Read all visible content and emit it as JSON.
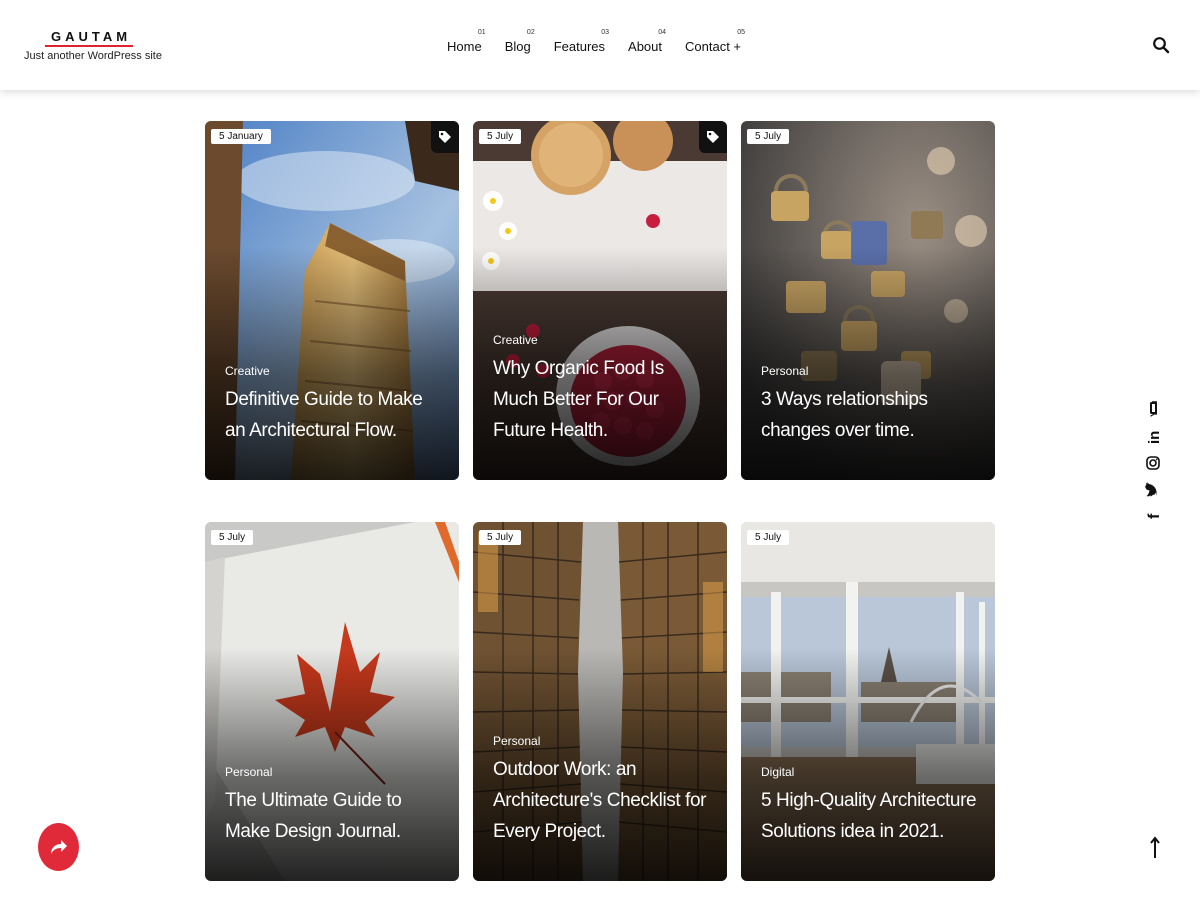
{
  "site": {
    "title": "GAUTAM",
    "tagline": "Just another WordPress site",
    "accent": "#e0222e"
  },
  "nav": [
    {
      "num": "01",
      "label": "Home"
    },
    {
      "num": "02",
      "label": "Blog"
    },
    {
      "num": "03",
      "label": "Features"
    },
    {
      "num": "04",
      "label": "About"
    },
    {
      "num": "05",
      "label": "Contact +"
    }
  ],
  "posts": [
    {
      "date": "5 January",
      "category": "Creative",
      "title": "Definitive Guide to Make an Architectural Flow.",
      "has_tag_icon": true,
      "image": "building-sky"
    },
    {
      "date": "5 July",
      "category": "Creative",
      "title": "Why Organic Food Is Much Better For Our Future Health.",
      "has_tag_icon": true,
      "image": "raspberries-cookies"
    },
    {
      "date": "5 July",
      "category": "Personal",
      "title": "3 Ways relationships changes over time.",
      "has_tag_icon": false,
      "image": "love-locks"
    },
    {
      "date": "5 July",
      "category": "Personal",
      "title": "The Ultimate Guide to Make Design Journal.",
      "has_tag_icon": false,
      "image": "maple-leaf-paper"
    },
    {
      "date": "5 July",
      "category": "Personal",
      "title": "Outdoor Work: an Architecture's Checklist for Every Project.",
      "has_tag_icon": false,
      "image": "glass-towers"
    },
    {
      "date": "5 July",
      "category": "Digital",
      "title": "5 High-Quality Architecture Solutions idea in 2021.",
      "has_tag_icon": false,
      "image": "interior-window"
    }
  ],
  "social_icons": [
    "youtube-icon",
    "linkedin-icon",
    "instagram-icon",
    "twitter-icon",
    "facebook-icon"
  ],
  "share_color": "#e02a3a"
}
